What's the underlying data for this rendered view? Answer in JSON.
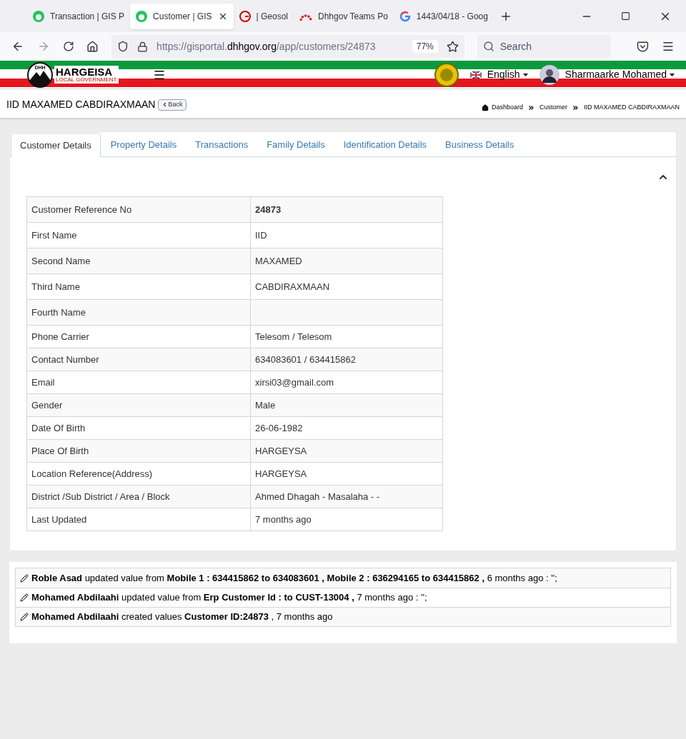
{
  "browser": {
    "tabs": [
      {
        "title": "Transaction | GIS P",
        "kind": "gis",
        "selected": false
      },
      {
        "title": "Customer | GIS",
        "kind": "gis",
        "selected": true
      },
      {
        "title": "| Geosol",
        "kind": "geosol",
        "selected": false
      },
      {
        "title": "Dhhgov Teams Po",
        "kind": "teams",
        "selected": false
      },
      {
        "title": "1443/04/18 - Goog",
        "kind": "google",
        "selected": false
      }
    ],
    "url_prefix": "https://gisportal.",
    "url_domain": "dhhgov.org",
    "url_path": "/app/customers/24873",
    "zoom": "77%",
    "search_placeholder": "Search"
  },
  "header": {
    "logo_title": "HARGEISA",
    "logo_subtitle": "LOCAL GOVERNMENT",
    "logo_letters": "DHH",
    "language": "English",
    "user": "Sharmaarke Mohamed"
  },
  "page": {
    "title": "IID MAXAMED CABDIRAXMAAN",
    "back": "Back",
    "breadcrumb": [
      "Dashboard",
      "Customer",
      "IID MAXAMED CABDIRAXMAAN"
    ]
  },
  "tabs": [
    {
      "label": "Customer Details",
      "selected": true
    },
    {
      "label": "Property Details",
      "selected": false
    },
    {
      "label": "Transactions",
      "selected": false
    },
    {
      "label": "Family Details",
      "selected": false
    },
    {
      "label": "Identification Details",
      "selected": false
    },
    {
      "label": "Business Details",
      "selected": false
    }
  ],
  "details": [
    {
      "label": "Customer Reference No",
      "value": "24873",
      "bold": true
    },
    {
      "label": "First Name",
      "value": "IID",
      "bold": false
    },
    {
      "label": "Second Name",
      "value": "MAXAMED",
      "bold": false
    },
    {
      "label": "Third Name",
      "value": "CABDIRAXMAAN",
      "bold": false
    },
    {
      "label": "Fourth Name"
    },
    {
      "label": "Phone Carrier",
      "value": "Telesom / Telesom",
      "bold": false
    },
    {
      "label": "Contact Number",
      "value": "634083601 / 634415862",
      "bold": false
    },
    {
      "label": "Email",
      "value": "xirsi03@gmail.com",
      "bold": false
    },
    {
      "label": "Gender",
      "value": "Male",
      "bold": false
    },
    {
      "label": "Date Of Birth",
      "value": "26-06-1982",
      "bold": false
    },
    {
      "label": "Place Of Birth",
      "value": "HARGEYSA",
      "bold": false
    },
    {
      "label": "Location Reference(Address)",
      "value": "HARGEYSA",
      "bold": false
    },
    {
      "label": "District /Sub District / Area / Block",
      "value": "Ahmed Dhagah - Masalaha - -",
      "bold": false
    },
    {
      "label": "Last Updated",
      "value": "7 months ago",
      "bold": false
    }
  ],
  "history": [
    "**Roble Asad** updated value from **Mobile 1 : 634415862 to 634083601 , Mobile 2 : 636294165 to 634415862 ,** 6 months ago : '';",
    "**Mohamed Abdilaahi** updated value from **Erp Customer Id : to CUST-13004 ,** 7 months ago : '';",
    "**Mohamed Abdilaahi** created values **Customer ID:24873** , 7 months ago"
  ]
}
